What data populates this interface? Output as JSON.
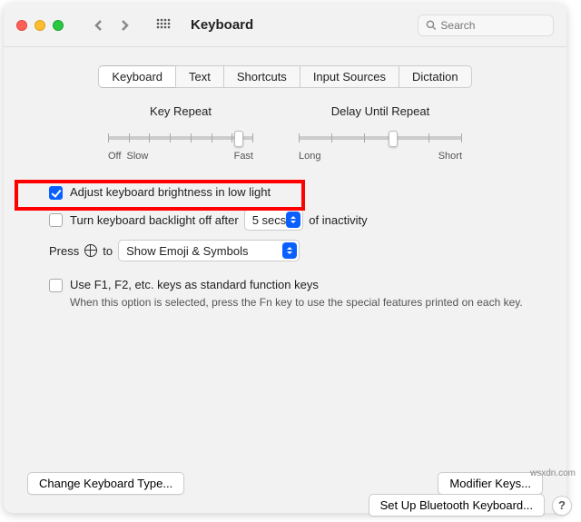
{
  "window": {
    "title": "Keyboard",
    "search_placeholder": "Search"
  },
  "tabs": [
    "Keyboard",
    "Text",
    "Shortcuts",
    "Input Sources",
    "Dictation"
  ],
  "active_tab": "Keyboard",
  "sliders": {
    "key_repeat": {
      "title": "Key Repeat",
      "left_label": "Off",
      "left_label2": "Slow",
      "right_label": "Fast",
      "value_pct": 90
    },
    "delay": {
      "title": "Delay Until Repeat",
      "left_label": "Long",
      "right_label": "Short",
      "value_pct": 58
    }
  },
  "options": {
    "adjust_brightness": {
      "label": "Adjust keyboard brightness in low light",
      "checked": true
    },
    "backlight_off": {
      "label_prefix": "Turn keyboard backlight off after",
      "select_value": "5 secs",
      "label_suffix": "of inactivity",
      "checked": false
    },
    "press_globe": {
      "label_prefix": "Press",
      "label_mid": "to",
      "select_value": "Show Emoji & Symbols"
    },
    "fn_keys": {
      "label": "Use F1, F2, etc. keys as standard function keys",
      "description": "When this option is selected, press the Fn key to use the special features printed on each key.",
      "checked": false
    }
  },
  "buttons": {
    "change_type": "Change Keyboard Type...",
    "modifier_keys": "Modifier Keys...",
    "bluetooth": "Set Up Bluetooth Keyboard...",
    "help": "?"
  },
  "watermark": "wsxdn.com"
}
